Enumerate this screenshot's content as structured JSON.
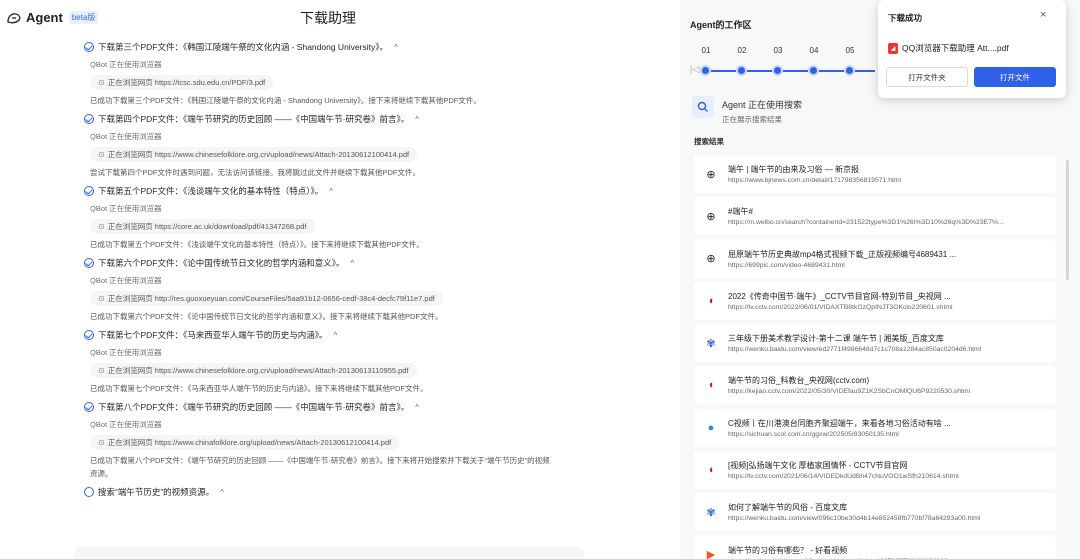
{
  "header": {
    "brand": "Agent",
    "beta": "beta版",
    "title": "下载助理"
  },
  "log": [
    {
      "step": "下载第三个PDF文件：《韩国江陵端午祭的文化内涵 - Shandong University》。",
      "qbot": "QBot 正在使用浏览器",
      "browse": "正在浏览网页 https://tcsc.sdu.edu.cn/PDF/3.pdf",
      "result": "已成功下载第三个PDF文件：《韩国江陵端午祭的文化内涵 - Shandong University》。接下来将继续下载其他PDF文件。"
    },
    {
      "step": "下载第四个PDF文件：《端午节研究的历史回顾 ——《中国端午节·研究卷》前言》。",
      "qbot": "QBot 正在使用浏览器",
      "browse": "正在浏览网页 https://www.chinesefolklore.org.cn/upload/news/Attach-20130612100414.pdf",
      "result": "尝试下载第四个PDF文件时遇到问题，无法访问该链接。我将跳过此文件并继续下载其他PDF文件。"
    },
    {
      "step": "下载第五个PDF文件：《浅谈端午文化的基本特性（特点）》。",
      "qbot": "QBot 正在使用浏览器",
      "browse": "正在浏览网页 https://core.ac.uk/download/pdf/41347268.pdf",
      "result": "已成功下载第五个PDF文件：《浅谈端午文化的基本特性（特点）》。接下来将继续下载其他PDF文件。"
    },
    {
      "step": "下载第六个PDF文件：《论中国传统节日文化的哲学内涵和意义》。",
      "qbot": "QBot 正在使用浏览器",
      "browse": "正在浏览网页 http://res.guoxueyuan.com/CourseFiles/5aa91b12-0656-cedf-38c4-decfc79f11e7.pdf",
      "result": "已成功下载第六个PDF文件：《论中国传统节日文化的哲学内涵和意义》。接下来将继续下载其他PDF文件。"
    },
    {
      "step": "下载第七个PDF文件：《马来西亚华人端午节的历史与内涵》。",
      "qbot": "QBot 正在使用浏览器",
      "browse": "正在浏览网页 https://www.chinesefolklore.org.cn/upload/news/Attach-20130613110955.pdf",
      "result": "已成功下载第七个PDF文件：《马来西亚华人端午节的历史与内涵》。接下来将继续下载其他PDF文件。"
    },
    {
      "step": "下载第八个PDF文件：《端午节研究的历史回顾 ——《中国端午节·研究卷》前言》。",
      "qbot": "QBot 正在使用浏览器",
      "browse": "正在浏览网页 https://www.chinafolklore.org/upload/news/Attach-20130612100414.pdf",
      "result": "已成功下载第八个PDF文件：《端午节研究的历史回顾 ——《中国端午节·研究卷》前言》。接下来将开始搜索并下载关于“端午节历史”的视频资源。"
    }
  ],
  "pending_step": "搜索“端午节历史”的视频资源。",
  "caret": "^",
  "workspace": {
    "title": "Agent的工作区",
    "steps": [
      "01",
      "02",
      "03",
      "04",
      "05"
    ],
    "status_title": "Agent 正在使用搜索",
    "status_sub": "正在展示搜索结果",
    "results_label": "搜索结果",
    "results": [
      {
        "icon": "globe-icon",
        "title": "端午 | 端午节的由来及习俗 — 新京报",
        "url": "https://www.bjnews.com.cn/detail/171798356819571.html"
      },
      {
        "icon": "globe-icon",
        "title": "#端午#",
        "url": "https://m.weibo.cn/search?containerid=231522type%3D1%26t%3D10%26q%3D%23E7%..."
      },
      {
        "icon": "globe-icon",
        "title": "屈原端午节历史典故mp4格式视频下载_正版视频编号4689431 ...",
        "url": "https://699pic.com/video-4689431.html"
      },
      {
        "icon": "cctv-icon",
        "title": "2022《传奇中国节·端午》_CCTV节目官网-特别节目_央视网 ...",
        "url": "https://tv.cctv.com/2022/06/01/VIDAXTB8tkGzQpINJT3OKclo220601.shtml"
      },
      {
        "icon": "baidu-icon",
        "title": "三年级下册美术教学设计-第十二课 端午节 | 湘美版_百度文库",
        "url": "https://wenku.baidu.com/view/ed2771f4986648d7c1c708a1284ac850ac0204d6.html"
      },
      {
        "icon": "cctv-icon",
        "title": "端午节的习俗_科教台_央视网(cctv.com)",
        "url": "https://kejiao.cctv.com/2022/05/30/VIDEfau9Z1K2SbCnOMlQU6P9220530.shtml"
      },
      {
        "icon": "sichuan-icon",
        "title": "C视频丨在川港澳台同胞齐聚迎端午，来看各地习俗活动有啥 ...",
        "url": "https://sichuan.scol.com.cn/ggxw/202505/83050135.html"
      },
      {
        "icon": "cctv-icon",
        "title": "[视频]弘扬端午文化 厚植家国情怀 - CCTV节目官网",
        "url": "https://tv.cctv.com/2021/06/14/VIDEDkdUdBh47cNuVOO1wSfh210614.shtml"
      },
      {
        "icon": "baidu-icon",
        "title": "如何了解端午节的风俗 - 百度文库",
        "url": "https://wenku.baidu.com/view/096c10be30d4b14e852458fb770bf78a64293a00.html"
      },
      {
        "icon": "haokan-icon",
        "title": "端午节的习俗有哪些？ - 好看视频",
        "url": "https://haokan.baidu.com/v?pd=wisenatural&vid=4265987786193198189"
      }
    ]
  },
  "popup": {
    "title": "下载成功",
    "close": "×",
    "file_name": "QQ浏览器下载助理 Att....pdf",
    "open_folder": "打开文件夹",
    "open_file": "打开文件"
  }
}
